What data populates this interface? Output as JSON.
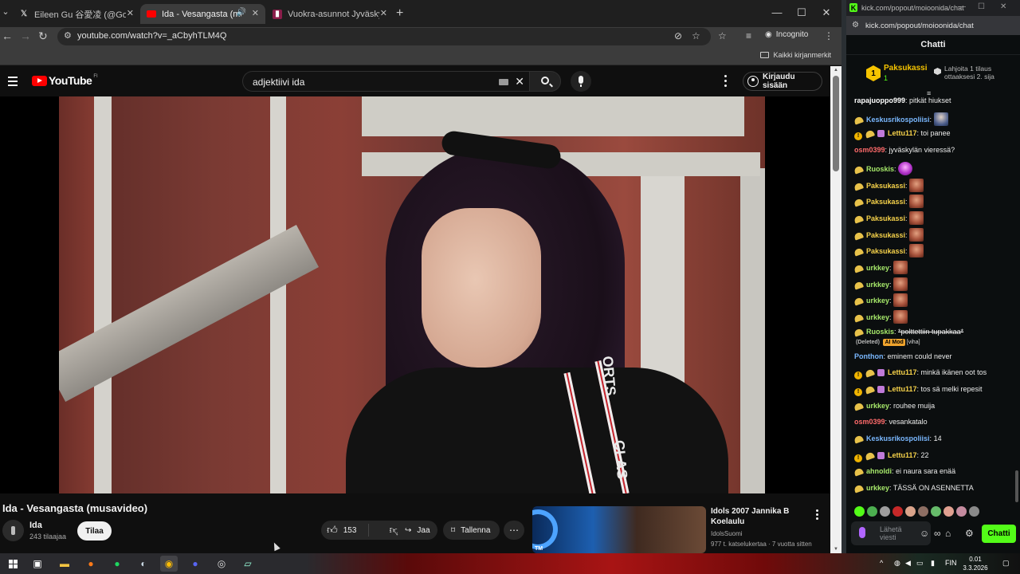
{
  "browser": {
    "tabs": [
      {
        "title": "Eileen Gu 谷愛凌 (@GoEileenG...",
        "favicon": "x-icon"
      },
      {
        "title": "Ida - Vesangasta (musavideo)",
        "favicon": "youtube-icon",
        "active": true
      },
      {
        "title": "Vuokra-asunnot Jyväskylä: 55 ...",
        "favicon": "oikotie-icon"
      }
    ],
    "url": "youtube.com/watch?v=_aCbyhTLM4Q",
    "incognito_label": "Incognito",
    "bookmarks_label": "Kaikki kirjanmerkit"
  },
  "youtube": {
    "logo_text": "YouTube",
    "country_code": "FI",
    "search_query": "adjektiivi ida",
    "signin_label": "Kirjaudu sisään",
    "video": {
      "title": "Ida - Vesangasta (musavideo)",
      "channel": "Ida",
      "subscribers": "243 tilaajaa",
      "subscribe_label": "Tilaa",
      "likes": "153",
      "share_label": "Jaa",
      "save_label": "Tallenna",
      "overlay_text_1": "ORTS",
      "overlay_text_2": "CLAS"
    },
    "recommended": {
      "title": "Idols 2007 Jannika B Koelaulu",
      "channel": "IdolsSuomi",
      "meta": "977 t. katselukertaa · 7 vuotta sitten",
      "thumb_label": "TM"
    }
  },
  "kick": {
    "window_title": "kick.com/popout/moioonida/chat",
    "url": "kick.com/popout/moioonida/chat",
    "chat_title": "Chatti",
    "pinned": {
      "rank": "1",
      "name": "Paksukassi",
      "count": "1",
      "text": "Lahjoita 1 tilaus ottaaksesi 2. sija"
    },
    "messages": [
      {
        "user": "rapajuoppo999",
        "color": "#ffffff",
        "text": "pitkät hiukset",
        "badges": []
      },
      {
        "user": "Keskusrikospoliisi",
        "color": "#7ab8ff",
        "text": "",
        "badges": [
          "ban"
        ],
        "emote": "blue"
      },
      {
        "user": "Lettu117",
        "color": "#f6d24a",
        "text": "toi panee",
        "badges": [
          "gift",
          "ban",
          "sub"
        ]
      },
      {
        "user": "osm0399",
        "color": "#ff6b6b",
        "text": "jyväskylän vieressä?",
        "badges": []
      },
      {
        "user": "Ruoskis",
        "color": "#a6e86a",
        "text": "",
        "badges": [
          "ban"
        ],
        "emote": "pink"
      },
      {
        "user": "Paksukassi",
        "color": "#f6d24a",
        "text": "",
        "badges": [
          "ban"
        ],
        "emote": "face"
      },
      {
        "user": "Paksukassi",
        "color": "#f6d24a",
        "text": "",
        "badges": [
          "ban"
        ],
        "emote": "face"
      },
      {
        "user": "Paksukassi",
        "color": "#f6d24a",
        "text": "",
        "badges": [
          "ban"
        ],
        "emote": "face"
      },
      {
        "user": "Paksukassi",
        "color": "#f6d24a",
        "text": "",
        "badges": [
          "ban"
        ],
        "emote": "face"
      },
      {
        "user": "Paksukassi",
        "color": "#f6d24a",
        "text": "",
        "badges": [
          "ban"
        ],
        "emote": "face"
      },
      {
        "user": "urkkey",
        "color": "#a6e86a",
        "text": "",
        "badges": [
          "ban"
        ],
        "emote": "face"
      },
      {
        "user": "urkkey",
        "color": "#a6e86a",
        "text": "",
        "badges": [
          "ban"
        ],
        "emote": "face"
      },
      {
        "user": "urkkey",
        "color": "#a6e86a",
        "text": "",
        "badges": [
          "ban"
        ],
        "emote": "face"
      },
      {
        "user": "urkkey",
        "color": "#a6e86a",
        "text": "",
        "badges": [
          "ban"
        ],
        "emote": "face"
      },
      {
        "user": "Ruoskis",
        "color": "#a6e86a",
        "text": "*polttettiin tupakkaa*",
        "badges": [
          "ban"
        ],
        "deleted": "(Deleted)",
        "mod": "AI Mod",
        "reason": "[viha]"
      },
      {
        "user": "Ponthon",
        "color": "#7ab8ff",
        "text": "eminem could never",
        "badges": []
      },
      {
        "user": "Lettu117",
        "color": "#f6d24a",
        "text": "minkä ikänen oot tos",
        "badges": [
          "gift",
          "ban",
          "sub"
        ]
      },
      {
        "user": "Lettu117",
        "color": "#f6d24a",
        "text": "tos sä melki repesit",
        "badges": [
          "gift",
          "ban",
          "sub"
        ]
      },
      {
        "user": "urkkey",
        "color": "#a6e86a",
        "text": "rouhee muija",
        "badges": [
          "ban"
        ]
      },
      {
        "user": "osm0399",
        "color": "#ff6b6b",
        "text": "vesankatalo",
        "badges": []
      },
      {
        "user": "Keskusrikospoliisi",
        "color": "#7ab8ff",
        "text": "14",
        "badges": [
          "ban"
        ]
      },
      {
        "user": "Lettu117",
        "color": "#f6d24a",
        "text": "22",
        "badges": [
          "gift",
          "ban",
          "sub"
        ]
      },
      {
        "user": "ahnoldi",
        "color": "#a6e86a",
        "text": "ei naura sara enää",
        "badges": [
          "ban"
        ]
      },
      {
        "user": "urkkey",
        "color": "#a6e86a",
        "text": "TÄSSÄ ON ASENNETTA",
        "badges": [
          "ban"
        ]
      }
    ],
    "input_placeholder": "Lähetä viesti",
    "send_label": "Chatti",
    "accent": "#53fc18"
  },
  "taskbar": {
    "language": "FIN",
    "time": "0.01",
    "date": "3.3.2026"
  }
}
